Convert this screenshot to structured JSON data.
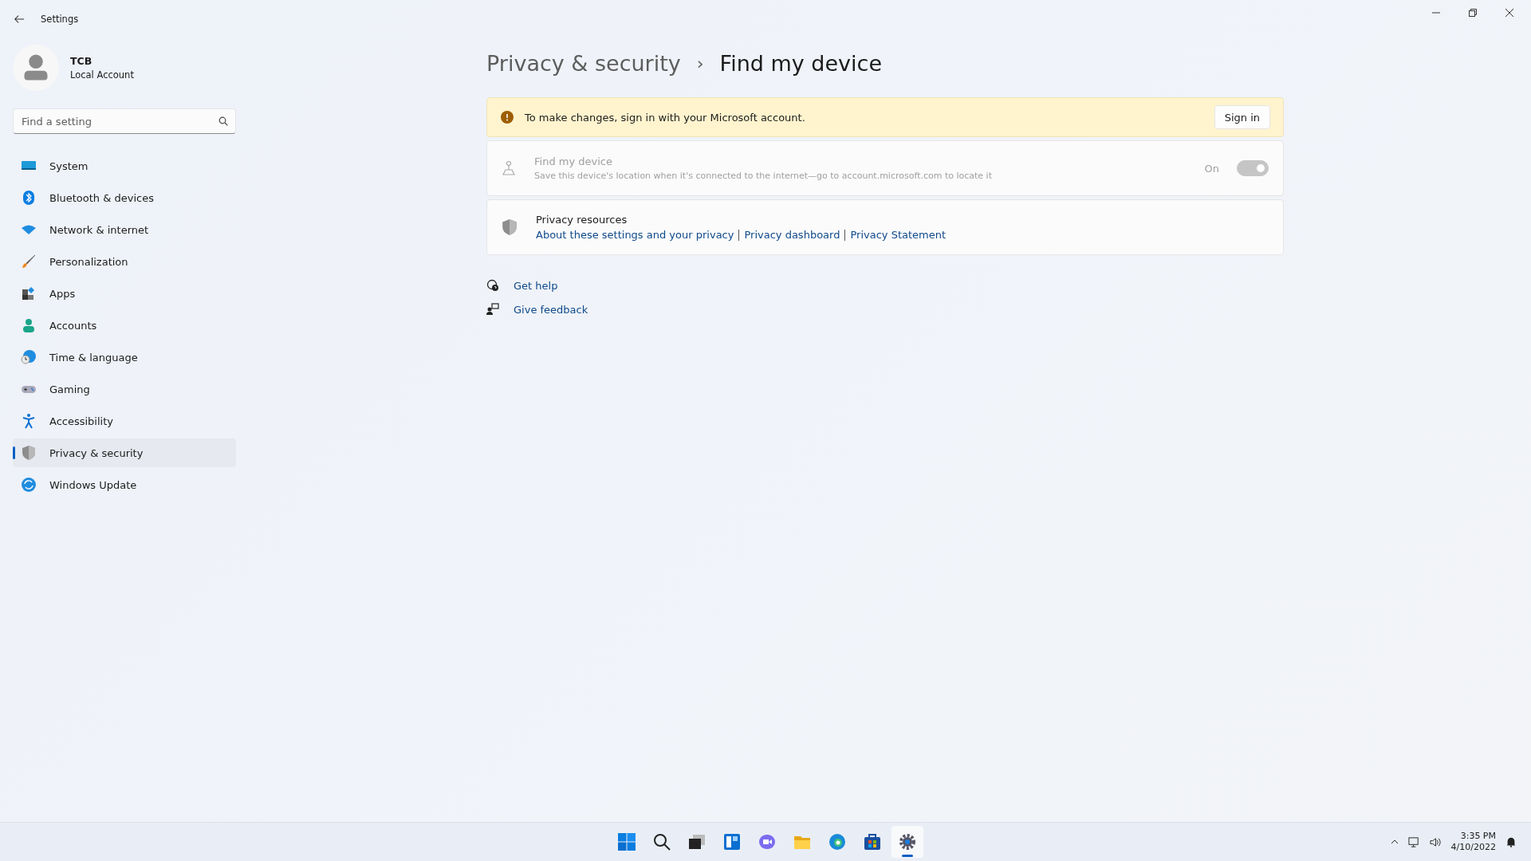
{
  "window": {
    "title": "Settings"
  },
  "account": {
    "name": "TCB",
    "type": "Local Account"
  },
  "search": {
    "placeholder": "Find a setting"
  },
  "sidebar": {
    "items": [
      {
        "label": "System",
        "selected": false
      },
      {
        "label": "Bluetooth & devices",
        "selected": false
      },
      {
        "label": "Network & internet",
        "selected": false
      },
      {
        "label": "Personalization",
        "selected": false
      },
      {
        "label": "Apps",
        "selected": false
      },
      {
        "label": "Accounts",
        "selected": false
      },
      {
        "label": "Time & language",
        "selected": false
      },
      {
        "label": "Gaming",
        "selected": false
      },
      {
        "label": "Accessibility",
        "selected": false
      },
      {
        "label": "Privacy & security",
        "selected": true
      },
      {
        "label": "Windows Update",
        "selected": false
      }
    ]
  },
  "breadcrumb": {
    "parent": "Privacy & security",
    "separator": "›",
    "current": "Find my device"
  },
  "banner": {
    "message": "To make changes, sign in with your Microsoft account.",
    "button": "Sign in"
  },
  "find_my_device": {
    "title": "Find my device",
    "description": "Save this device's location when it's connected to the internet—go to account.microsoft.com to locate it",
    "state_label": "On",
    "on": true,
    "disabled": true
  },
  "privacy_resources": {
    "title": "Privacy resources",
    "links": [
      "About these settings and your privacy",
      "Privacy dashboard",
      "Privacy Statement"
    ]
  },
  "help_links": [
    "Get help",
    "Give feedback"
  ],
  "taskbar": {
    "apps": [
      {
        "selected": false
      },
      {
        "selected": false
      },
      {
        "selected": false
      },
      {
        "selected": false
      },
      {
        "selected": false
      },
      {
        "selected": false
      },
      {
        "selected": false
      },
      {
        "selected": false
      },
      {
        "selected": true
      }
    ],
    "time": "3:35 PM",
    "date": "4/10/2022"
  }
}
